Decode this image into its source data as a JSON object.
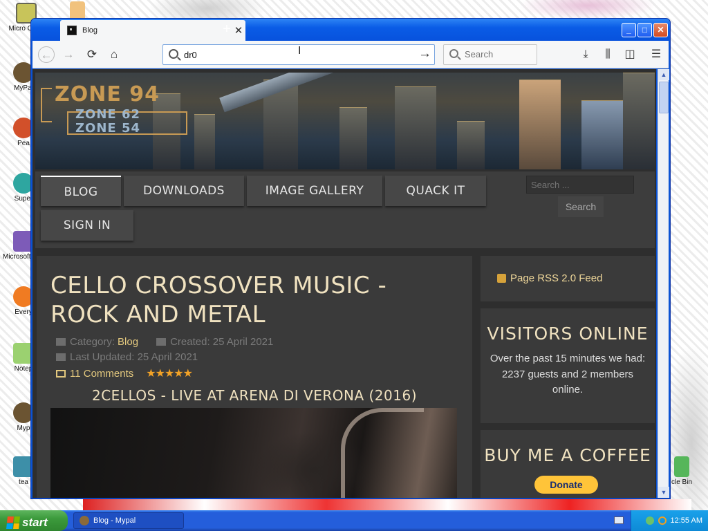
{
  "desktop": {
    "icons": [
      {
        "label": "Micro Outlo"
      },
      {
        "label": "MyPal"
      },
      {
        "label": "Pea"
      },
      {
        "label": "Super"
      },
      {
        "label": "Microsoft Studio"
      },
      {
        "label": "Every"
      },
      {
        "label": "Notep"
      },
      {
        "label": "Myp"
      },
      {
        "label": "tea"
      },
      {
        "label": "cle Bin"
      }
    ]
  },
  "taskbar": {
    "start_label": "start",
    "task_label": "Blog - Mypal",
    "clock": "12:55 AM"
  },
  "browser": {
    "tab_title": "Blog",
    "url_value": "dr0",
    "search_placeholder": "Search",
    "icons": {
      "back": "back-arrow-icon",
      "forward": "forward-arrow-icon",
      "reload": "reload-icon",
      "home": "home-icon",
      "download": "download-icon",
      "library": "library-icon",
      "sidebar": "sidebar-icon",
      "menu": "hamburger-menu-icon"
    }
  },
  "site": {
    "logo": {
      "main": "ZONE 94",
      "sub1": "ZONE 62",
      "sub2": "ZONE 54"
    },
    "nav": [
      {
        "label": "BLOG",
        "active": true
      },
      {
        "label": "DOWNLOADS"
      },
      {
        "label": "IMAGE GALLERY"
      },
      {
        "label": "QUACK IT"
      },
      {
        "label": "SIGN IN"
      }
    ],
    "search_placeholder": "Search ...",
    "search_button": "Search",
    "article": {
      "title": "CELLO CROSSOVER MUSIC - ROCK AND METAL",
      "category_label": "Category:",
      "category_link": "Blog",
      "created": "Created: 25 April 2021",
      "updated": "Last Updated: 25 April 2021",
      "comments": "11 Comments",
      "rating_stars": 5,
      "video_title": "2CELLOS - LIVE AT ARENA DI VERONA (2016)"
    },
    "sidebar": {
      "rss": "Page RSS 2.0 Feed",
      "visitors_title": "VISITORS ONLINE",
      "visitors_text": "Over the past 15 minutes we had: 2237 guests and 2 members online.",
      "coffee_title": "BUY ME A COFFEE",
      "donate_label": "Donate"
    }
  },
  "colors": {
    "accent_gold": "#f0e2c0",
    "link_gold": "#e3c87e",
    "star_orange": "#f3a327",
    "donate_yellow": "#ffc439",
    "xp_blue": "#245edb"
  }
}
